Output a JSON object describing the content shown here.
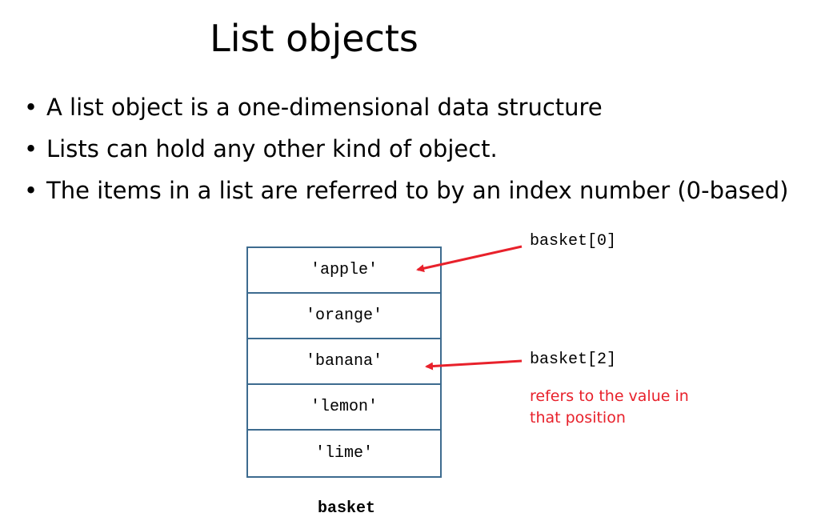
{
  "slide": {
    "title": "List objects",
    "bullets": [
      "A list object is a one-dimensional data structure",
      "Lists can hold any other kind of object.",
      "The items in a list are referred to by an index number (0-based)"
    ]
  },
  "diagram": {
    "items": [
      "'apple'",
      "'orange'",
      "'banana'",
      "'lemon'",
      "'lime'"
    ],
    "variable_name": "basket",
    "labels": {
      "index0": "basket[0]",
      "index2": "basket[2]"
    },
    "note": "refers to the value in that position",
    "arrow_color": "#e8212b",
    "box_color": "#3d6b8f"
  }
}
